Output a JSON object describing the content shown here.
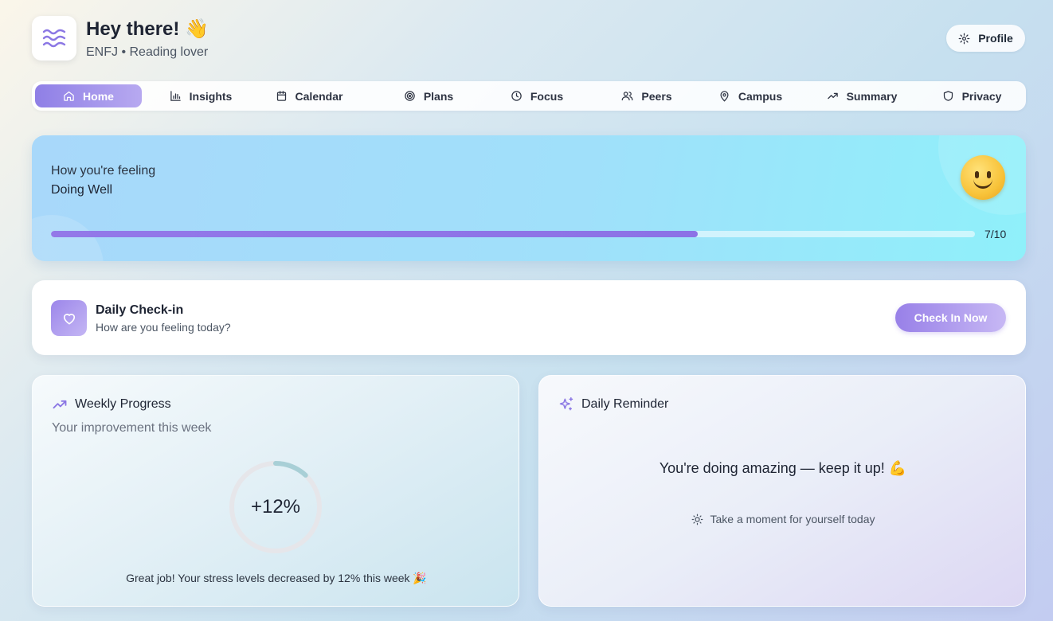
{
  "header": {
    "greeting": "Hey there! 👋",
    "subtitle": "ENFJ • Reading lover",
    "logo_icon": "waves-icon",
    "profile_label": "Profile"
  },
  "nav": {
    "active": "Home",
    "tabs": [
      {
        "label": "Home",
        "icon": "home-icon"
      },
      {
        "label": "Insights",
        "icon": "bar-chart-icon"
      },
      {
        "label": "Calendar",
        "icon": "calendar-icon"
      },
      {
        "label": "Plans",
        "icon": "target-icon"
      },
      {
        "label": "Focus",
        "icon": "clock-icon"
      },
      {
        "label": "Peers",
        "icon": "users-icon"
      },
      {
        "label": "Campus",
        "icon": "map-pin-icon"
      },
      {
        "label": "Summary",
        "icon": "trending-up-icon"
      },
      {
        "label": "Privacy",
        "icon": "shield-icon"
      }
    ]
  },
  "mood": {
    "label": "How you're feeling",
    "value": "Doing Well",
    "score_text": "7/10",
    "score_fraction": 0.7,
    "emoji": "slightly-smiling-face-icon"
  },
  "checkin": {
    "title": "Daily Check-in",
    "subtitle": "How are you feeling today?",
    "button": "Check In Now",
    "icon": "heart-icon"
  },
  "weekly": {
    "title": "Weekly Progress",
    "subtitle": "Your improvement this week",
    "value": "+12%",
    "progress_fraction": 0.12,
    "note": "Great job! Your stress levels decreased by 12% this week 🎉"
  },
  "reminder": {
    "title": "Daily Reminder",
    "message": "You're doing amazing — keep it up! 💪",
    "tip": "Take a moment for yourself today"
  },
  "colors": {
    "accent": "#8f7fe6",
    "ring_track": "#e6e6ea",
    "ring_fill": "#a8cfd6"
  }
}
